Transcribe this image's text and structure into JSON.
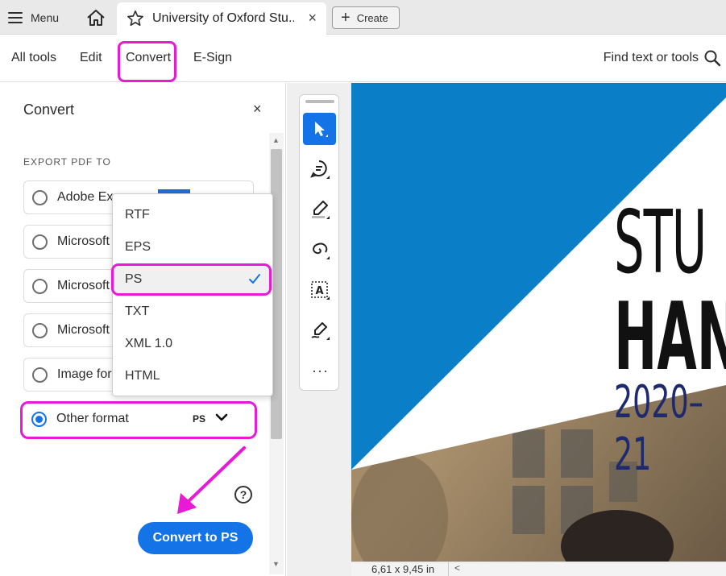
{
  "tabbar": {
    "menu_label": "Menu",
    "tab_title": "University of Oxford Stu...",
    "tab_close": "×",
    "create_label": "Create"
  },
  "toolbar": {
    "tabs": [
      "All tools",
      "Edit",
      "Convert",
      "E-Sign"
    ],
    "active_tab": "Convert",
    "find_label": "Find text or tools"
  },
  "panel": {
    "title": "Convert",
    "close": "×",
    "section_label": "EXPORT PDF TO",
    "options": [
      {
        "label": "Adobe Ex",
        "checked": false
      },
      {
        "label": "Microsoft",
        "checked": false
      },
      {
        "label": "Microsoft",
        "checked": false
      },
      {
        "label": "Microsoft",
        "checked": false
      },
      {
        "label": "Image for",
        "checked": false
      },
      {
        "label": "Other format",
        "checked": true,
        "format": "PS"
      }
    ],
    "help": "?",
    "convert_button": "Convert to PS"
  },
  "dropdown": {
    "items": [
      "RTF",
      "EPS",
      "PS",
      "TXT",
      "XML 1.0",
      "HTML"
    ],
    "selected": "PS"
  },
  "vertical_tools": [
    "select-icon",
    "comment-icon",
    "highlight-icon",
    "draw-icon",
    "text-box-icon",
    "sign-icon",
    "more-icon"
  ],
  "vertical_tools_more": "···",
  "document": {
    "line1": "STU",
    "line2": "HAN",
    "line3": "2020–21"
  },
  "status": {
    "page_size": "6,61 x 9,45 in",
    "scroll_left": "<"
  },
  "colors": {
    "accent": "#1473e6",
    "highlight": "#e81ad8",
    "doc_blue": "#0a7fc7"
  }
}
